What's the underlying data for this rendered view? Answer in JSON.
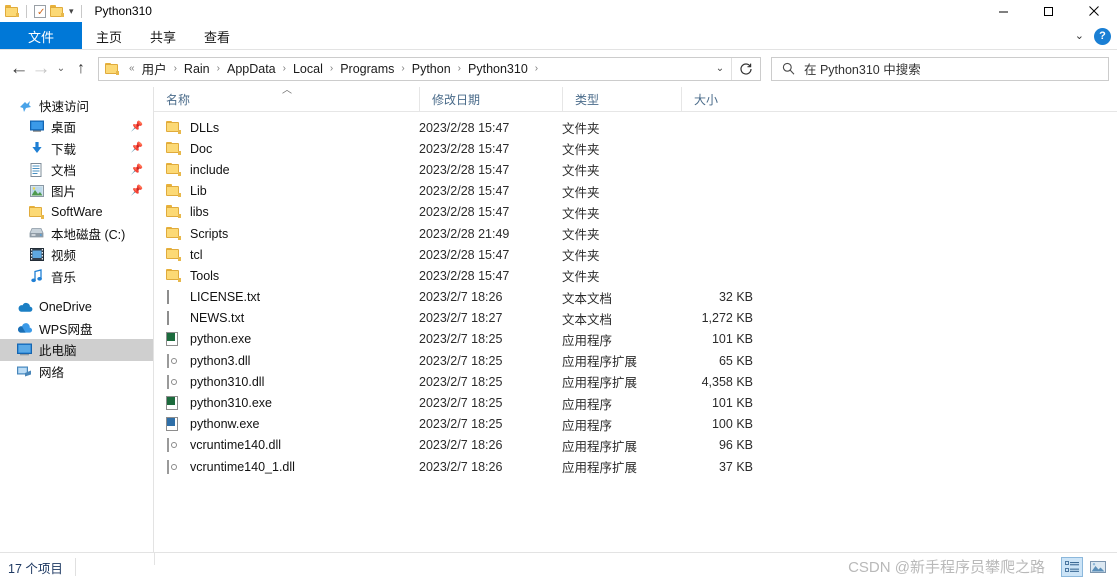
{
  "window": {
    "title": "Python310",
    "quick_access": [
      {
        "name": "folder-icon",
        "label": ""
      },
      {
        "name": "properties-icon",
        "label": ""
      },
      {
        "name": "new-folder-icon",
        "label": ""
      },
      {
        "name": "customize-caret",
        "label": "▾"
      }
    ],
    "controls": {
      "minimize": "—",
      "maximize": "▫",
      "close": "✕"
    }
  },
  "ribbon": {
    "tabs": [
      {
        "label": "文件",
        "active": true
      },
      {
        "label": "主页",
        "active": false
      },
      {
        "label": "共享",
        "active": false
      },
      {
        "label": "查看",
        "active": false
      }
    ],
    "collapse_caret": "⌄",
    "help_label": "?",
    "accent_color": "#0078d7"
  },
  "nav": {
    "back": "←",
    "forward": "→",
    "recent": "⌄",
    "up": "↑",
    "breadcrumb_prefix": "«",
    "breadcrumbs": [
      "用户",
      "Rain",
      "AppData",
      "Local",
      "Programs",
      "Python",
      "Python310"
    ],
    "breadcrumb_separator": "›",
    "dropdown_caret": "⌄",
    "refresh": "↻"
  },
  "search": {
    "placeholder": "在 Python310 中搜索",
    "icon": "search-icon"
  },
  "sidebar": {
    "groups": [
      {
        "header": {
          "label": "快速访问",
          "icon": "pin-star-icon"
        },
        "items": [
          {
            "label": "桌面",
            "icon": "desktop-icon",
            "pinned": true
          },
          {
            "label": "下载",
            "icon": "download-icon",
            "pinned": true
          },
          {
            "label": "文档",
            "icon": "documents-icon",
            "pinned": true
          },
          {
            "label": "图片",
            "icon": "pictures-icon",
            "pinned": true
          },
          {
            "label": "SoftWare",
            "icon": "folder-icon",
            "pinned": false
          },
          {
            "label": "本地磁盘 (C:)",
            "icon": "drive-icon",
            "pinned": false
          },
          {
            "label": "视频",
            "icon": "videos-icon",
            "pinned": false
          },
          {
            "label": "音乐",
            "icon": "music-icon",
            "pinned": false
          }
        ]
      },
      {
        "header": null,
        "items": [
          {
            "label": "OneDrive",
            "icon": "onedrive-icon",
            "pinned": false
          },
          {
            "label": "WPS网盘",
            "icon": "wps-cloud-icon",
            "pinned": false
          },
          {
            "label": "此电脑",
            "icon": "this-pc-icon",
            "pinned": false,
            "selected": true
          },
          {
            "label": "网络",
            "icon": "network-icon",
            "pinned": false
          }
        ]
      }
    ]
  },
  "columns": {
    "name": "名称",
    "date": "修改日期",
    "type": "类型",
    "size": "大小",
    "sort_indicator": "︿",
    "sorted_by": "名称",
    "sort_direction": "ascending"
  },
  "files": [
    {
      "name": "DLLs",
      "date": "2023/2/28 15:47",
      "type": "文件夹",
      "size": "",
      "icon": "folder-icon"
    },
    {
      "name": "Doc",
      "date": "2023/2/28 15:47",
      "type": "文件夹",
      "size": "",
      "icon": "folder-icon"
    },
    {
      "name": "include",
      "date": "2023/2/28 15:47",
      "type": "文件夹",
      "size": "",
      "icon": "folder-icon"
    },
    {
      "name": "Lib",
      "date": "2023/2/28 15:47",
      "type": "文件夹",
      "size": "",
      "icon": "folder-icon"
    },
    {
      "name": "libs",
      "date": "2023/2/28 15:47",
      "type": "文件夹",
      "size": "",
      "icon": "folder-icon"
    },
    {
      "name": "Scripts",
      "date": "2023/2/28 21:49",
      "type": "文件夹",
      "size": "",
      "icon": "folder-icon"
    },
    {
      "name": "tcl",
      "date": "2023/2/28 15:47",
      "type": "文件夹",
      "size": "",
      "icon": "folder-icon"
    },
    {
      "name": "Tools",
      "date": "2023/2/28 15:47",
      "type": "文件夹",
      "size": "",
      "icon": "folder-icon"
    },
    {
      "name": "LICENSE.txt",
      "date": "2023/2/7 18:26",
      "type": "文本文档",
      "size": "32 KB",
      "icon": "text-file-icon"
    },
    {
      "name": "NEWS.txt",
      "date": "2023/2/7 18:27",
      "type": "文本文档",
      "size": "1,272 KB",
      "icon": "text-file-icon"
    },
    {
      "name": "python.exe",
      "date": "2023/2/7 18:25",
      "type": "应用程序",
      "size": "101 KB",
      "icon": "python-exe-icon"
    },
    {
      "name": "python3.dll",
      "date": "2023/2/7 18:25",
      "type": "应用程序扩展",
      "size": "65 KB",
      "icon": "dll-icon"
    },
    {
      "name": "python310.dll",
      "date": "2023/2/7 18:25",
      "type": "应用程序扩展",
      "size": "4,358 KB",
      "icon": "dll-icon"
    },
    {
      "name": "python310.exe",
      "date": "2023/2/7 18:25",
      "type": "应用程序",
      "size": "101 KB",
      "icon": "python-exe-icon"
    },
    {
      "name": "pythonw.exe",
      "date": "2023/2/7 18:25",
      "type": "应用程序",
      "size": "100 KB",
      "icon": "pythonw-exe-icon"
    },
    {
      "name": "vcruntime140.dll",
      "date": "2023/2/7 18:26",
      "type": "应用程序扩展",
      "size": "96 KB",
      "icon": "dll-icon"
    },
    {
      "name": "vcruntime140_1.dll",
      "date": "2023/2/7 18:26",
      "type": "应用程序扩展",
      "size": "37 KB",
      "icon": "dll-icon"
    }
  ],
  "status": {
    "item_count": "17 个项目",
    "view_details": "details-view-button",
    "view_large_icons": "large-icons-view-button"
  },
  "watermark": "CSDN @新手程序员攀爬之路"
}
